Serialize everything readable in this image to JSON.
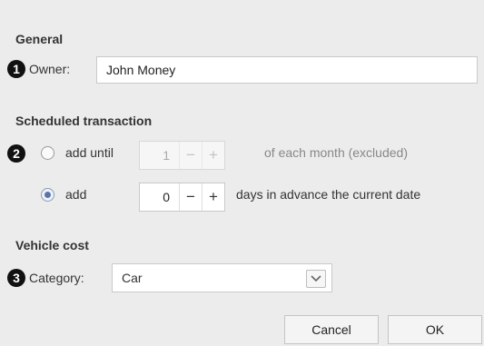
{
  "general": {
    "title": "General",
    "owner_label": "Owner:",
    "owner_value": "John Money",
    "marker": "1"
  },
  "scheduled": {
    "title": "Scheduled transaction",
    "marker": "2",
    "option1": {
      "label": "add until",
      "value": "1",
      "suffix": "of each month (excluded)",
      "selected": false,
      "enabled": false
    },
    "option2": {
      "label": "add",
      "value": "0",
      "suffix": "days in advance the current date",
      "selected": true,
      "enabled": true
    },
    "minus": "−",
    "plus": "+"
  },
  "vehicle": {
    "title": "Vehicle cost",
    "marker": "3",
    "category_label": "Category:",
    "category_value": "Car"
  },
  "buttons": {
    "cancel": "Cancel",
    "ok": "OK"
  },
  "icons": {
    "dropdown": "chevron-down-icon"
  }
}
